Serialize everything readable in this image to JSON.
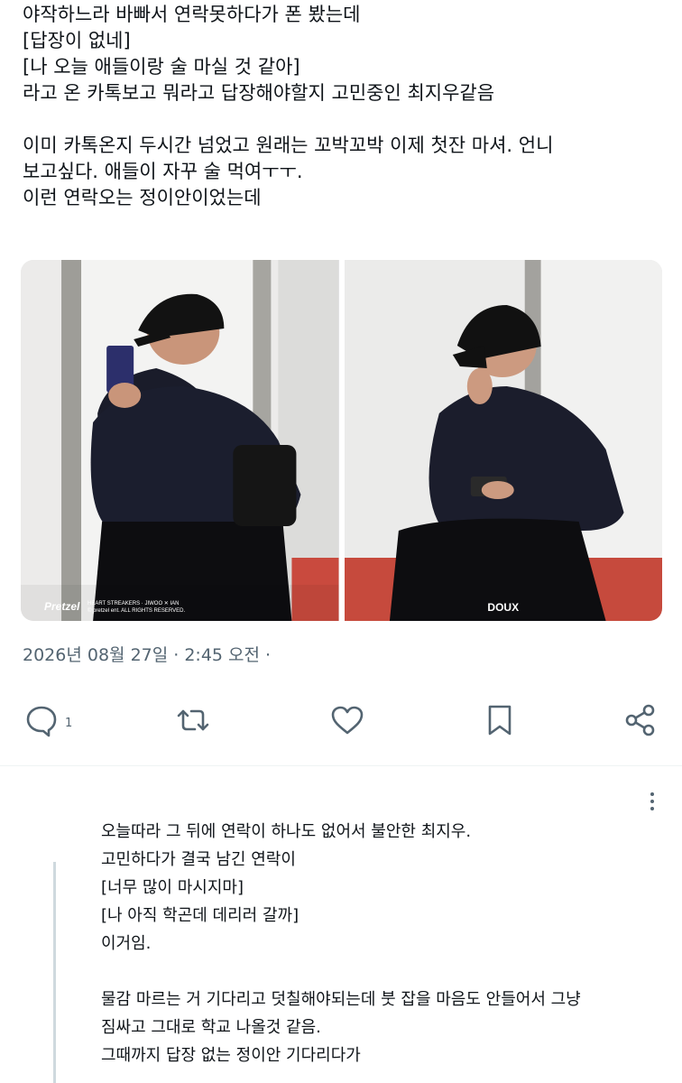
{
  "post": {
    "lines": [
      "야작하느라 바빠서 연락못하다가 폰 봤는데",
      "[답장이 없네]",
      "[나 오늘 애들이랑 술 마실 것 같아]",
      "라고 온 카톡보고 뭐라고 답장해야할지 고민중인 최지우같음",
      "",
      "이미 카톡온지 두시간 넘었고 원래는 꼬박꼬박 이제 첫잔 마셔. 언니",
      "보고싶다. 애들이 자꾸 술 먹여ㅜㅜ.",
      "이런 연락오는 정이안이었는데"
    ],
    "images": [
      {
        "watermark_left": "Pretzel",
        "watermark_small": "HEART STREAKERS · JIWOO ✕ IAN",
        "watermark_small2": "© pretzel ent. ALL RIGHTS RESERVED."
      },
      {
        "watermark_center": "DOUX"
      }
    ],
    "timestamp": "2026년 08월 27일 · 2:45 오전 ·"
  },
  "actions": {
    "reply_count": "1",
    "icons": [
      "reply-icon",
      "retweet-icon",
      "like-icon",
      "bookmark-icon",
      "share-icon"
    ]
  },
  "reply": {
    "lines": [
      "오늘따라 그 뒤에 연락이 하나도 없어서  불안한 최지우.",
      "고민하다가 결국 남긴 연락이",
      "[너무 많이 마시지마]",
      "[나 아직 학곤데 데리러 갈까]",
      "이거임.",
      "",
      "물감 마르는 거 기다리고 덧칠해야되는데 붓 잡을 마음도 안들어서 그냥",
      "짐싸고 그대로 학교 나올것 같음.",
      "그때까지 답장 없는 정이안 기다리다가"
    ]
  },
  "colors": {
    "text": "#0f1419",
    "muted": "#536471",
    "divider": "#eff3f4",
    "thread": "#cfd9de"
  }
}
